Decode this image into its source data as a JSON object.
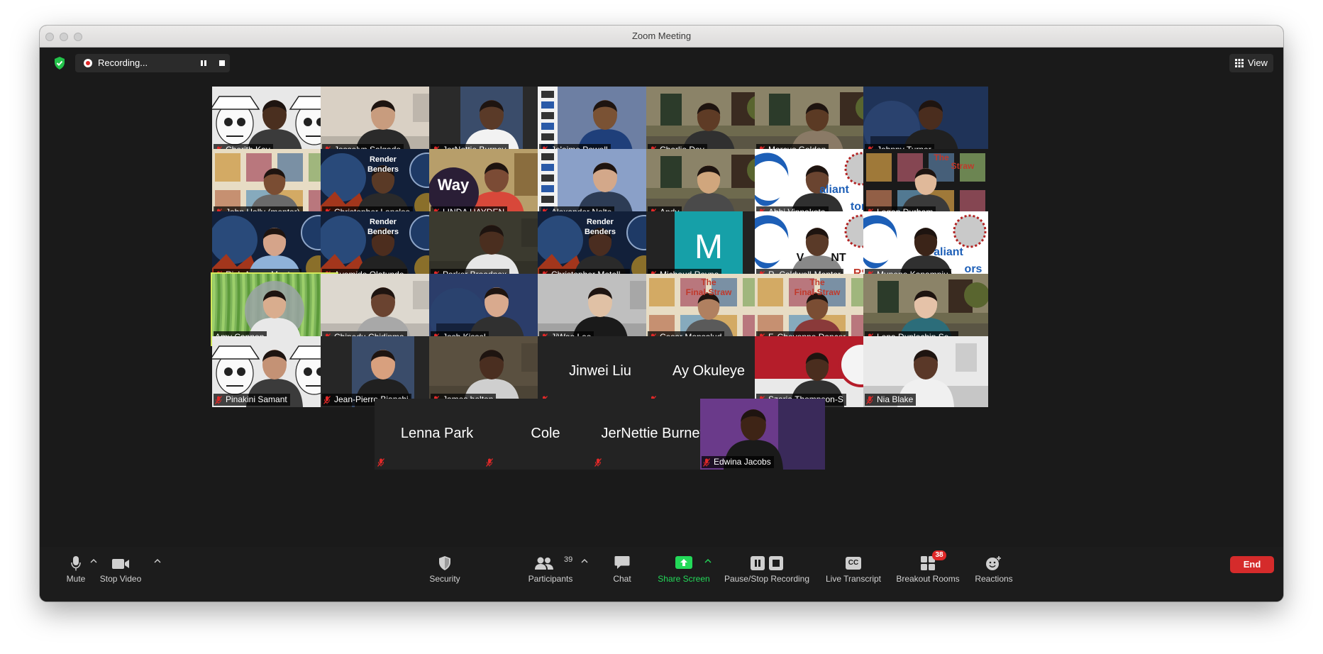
{
  "window": {
    "title": "Zoom Meeting"
  },
  "top_bar": {
    "recording_label": "Recording...",
    "view_label": "View"
  },
  "participants": [
    {
      "name": "Cherith Kay"
    },
    {
      "name": "Josselyn Salgado"
    },
    {
      "name": "JerNettie Burney"
    },
    {
      "name": "Je'aime Powell"
    },
    {
      "name": "Charlie Dey"
    },
    {
      "name": "Marcus Golden"
    },
    {
      "name": "Johnny Turner"
    },
    {
      "name": "John Holly (mentor)"
    },
    {
      "name": "Christopher Lanclos",
      "overlay": [
        "Render",
        "Benders"
      ]
    },
    {
      "name": "LINDA HAYDEN",
      "overlay": [
        "Way"
      ]
    },
    {
      "name": "Alexander Nolte"
    },
    {
      "name": "Andy"
    },
    {
      "name": "Abhi Vinnakota",
      "overlay": [
        "aliant",
        "tors"
      ]
    },
    {
      "name": "Logan Durham",
      "overlay": [
        "The",
        "Straw"
      ]
    },
    {
      "name": "Rich Asay - Mentos"
    },
    {
      "name": "Ayomide Olatunde",
      "overlay": [
        "Render",
        "Benders"
      ]
    },
    {
      "name": "Parker Broadnax"
    },
    {
      "name": "Christopher Metell...",
      "overlay": [
        "Render",
        "Benders"
      ]
    },
    {
      "name": "Michaud Reyna",
      "avatar_letter": "M"
    },
    {
      "name": "R. Caldwell-Mentor",
      "overlay": [
        "V",
        "NT",
        "RS"
      ]
    },
    {
      "name": "Munene Kanampiu",
      "overlay": [
        "aliant",
        "ors"
      ]
    },
    {
      "name": "Amy Cannon"
    },
    {
      "name": "Chinedu Chidinma"
    },
    {
      "name": "Josh Kissel"
    },
    {
      "name": "JiWoo Lee"
    },
    {
      "name": "Cesar Monsalud",
      "overlay": [
        "The",
        "Final-Straw"
      ]
    },
    {
      "name": "F. Chevonne Dancer",
      "overlay": [
        "The",
        "Final-Straw"
      ]
    },
    {
      "name": "Lena Duplechin Se..."
    },
    {
      "name": "Pinakini Samant"
    },
    {
      "name": "Jean-Pierre Bianchi"
    },
    {
      "name": "James belton"
    },
    {
      "name": "Jinwei Liu"
    },
    {
      "name": "Ay Okuleye"
    },
    {
      "name": "Szaria Thompson-S"
    },
    {
      "name": "Nia Blake"
    },
    {
      "name": "Lenna Park"
    },
    {
      "name": "Cole"
    },
    {
      "name": "JerNettie Burney"
    },
    {
      "name": "Edwina Jacobs"
    }
  ],
  "toolbar": {
    "mute": "Mute",
    "stop_video": "Stop Video",
    "security": "Security",
    "participants": "Participants",
    "participants_count": "39",
    "chat": "Chat",
    "share_screen": "Share Screen",
    "pause_stop_recording": "Pause/Stop Recording",
    "live_transcript": "Live Transcript",
    "breakout_rooms": "Breakout Rooms",
    "breakout_badge": "38",
    "reactions": "Reactions",
    "end": "End",
    "cc_glyph": "CC"
  },
  "colors": {
    "meeting_bg": "#1a1a1a",
    "toolbar_bg": "#1c1c1c",
    "share_green": "#23d959",
    "end_red": "#d52b2b",
    "active_speaker": "#d2e85a",
    "muted_red": "#e02828",
    "avatar_teal": "#16a0a8"
  }
}
